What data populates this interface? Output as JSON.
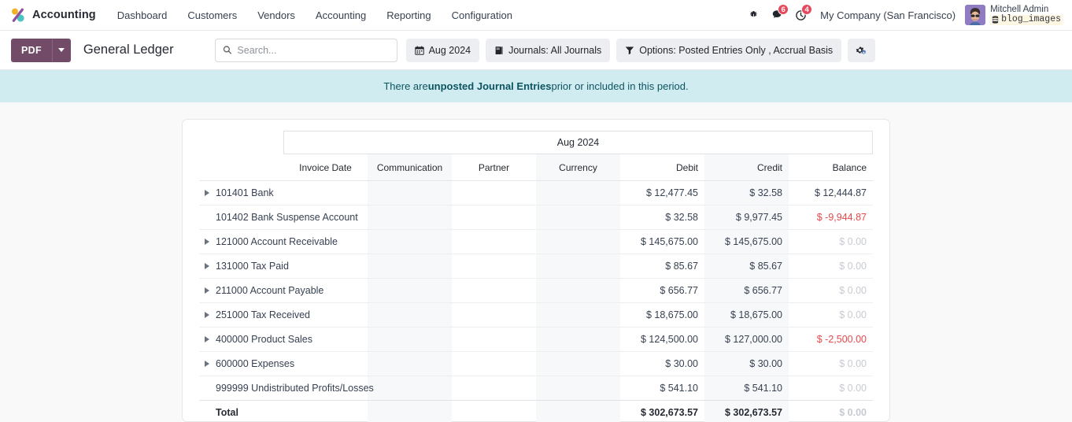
{
  "navbar": {
    "brand": "Accounting",
    "brand_logo_icon": "odoo-accounting-logo",
    "menu": [
      {
        "label": "Dashboard",
        "name": "dashboard"
      },
      {
        "label": "Customers",
        "name": "customers"
      },
      {
        "label": "Vendors",
        "name": "vendors"
      },
      {
        "label": "Accounting",
        "name": "accounting"
      },
      {
        "label": "Reporting",
        "name": "reporting"
      },
      {
        "label": "Configuration",
        "name": "configuration"
      }
    ],
    "sys_icons": [
      {
        "name": "bug-icon",
        "badge": ""
      },
      {
        "name": "messages-icon",
        "badge": "6"
      },
      {
        "name": "activities-clock-icon",
        "badge": "4"
      }
    ],
    "company": "My Company (San Francisco)",
    "user": {
      "name": "Mitchell Admin",
      "database": "blog_images",
      "database_icon": "database-icon",
      "avatar_icon": "user-avatar"
    }
  },
  "control_panel": {
    "pdf_label": "PDF",
    "pdf_caret_icon": "caret-down-icon",
    "page_title": "General Ledger",
    "search": {
      "placeholder": "Search...",
      "value": "",
      "icon": "search-icon"
    },
    "filters": [
      {
        "name": "date-filter",
        "icon": "calendar-icon",
        "label": "Aug 2024"
      },
      {
        "name": "journals-filter",
        "icon": "book-icon",
        "label": "Journals: All Journals"
      },
      {
        "name": "options-filter",
        "icon": "filter-icon",
        "label": "Options: Posted Entries Only , Accrual Basis"
      }
    ],
    "settings_button": {
      "name": "report-settings-button",
      "icon": "cogs-icon"
    }
  },
  "alert": {
    "prefix": "There are ",
    "strong": "unposted Journal Entries",
    "suffix": " prior or included in this period."
  },
  "report": {
    "period_header": "Aug 2024",
    "columns": [
      {
        "key": "name",
        "label": ""
      },
      {
        "key": "invoice_date",
        "label": "Invoice Date"
      },
      {
        "key": "communication",
        "label": "Communication"
      },
      {
        "key": "partner",
        "label": "Partner"
      },
      {
        "key": "currency",
        "label": "Currency"
      },
      {
        "key": "debit",
        "label": "Debit"
      },
      {
        "key": "credit",
        "label": "Credit"
      },
      {
        "key": "balance",
        "label": "Balance"
      }
    ],
    "rows": [
      {
        "account": "101401 Bank",
        "expandable": true,
        "invoice_date": "",
        "communication": "",
        "partner": "",
        "currency": "",
        "debit": "$ 12,477.45",
        "credit": "$ 32.58",
        "balance": "$ 12,444.87",
        "balance_style": "normal"
      },
      {
        "account": "101402 Bank Suspense Account",
        "expandable": false,
        "invoice_date": "",
        "communication": "",
        "partner": "",
        "currency": "",
        "debit": "$ 32.58",
        "credit": "$ 9,977.45",
        "balance": "$ -9,944.87",
        "balance_style": "negative"
      },
      {
        "account": "121000 Account Receivable",
        "expandable": true,
        "invoice_date": "",
        "communication": "",
        "partner": "",
        "currency": "",
        "debit": "$ 145,675.00",
        "credit": "$ 145,675.00",
        "balance": "$ 0.00",
        "balance_style": "zero"
      },
      {
        "account": "131000 Tax Paid",
        "expandable": true,
        "invoice_date": "",
        "communication": "",
        "partner": "",
        "currency": "",
        "debit": "$ 85.67",
        "credit": "$ 85.67",
        "balance": "$ 0.00",
        "balance_style": "zero"
      },
      {
        "account": "211000 Account Payable",
        "expandable": true,
        "invoice_date": "",
        "communication": "",
        "partner": "",
        "currency": "",
        "debit": "$ 656.77",
        "credit": "$ 656.77",
        "balance": "$ 0.00",
        "balance_style": "zero"
      },
      {
        "account": "251000 Tax Received",
        "expandable": true,
        "invoice_date": "",
        "communication": "",
        "partner": "",
        "currency": "",
        "debit": "$ 18,675.00",
        "credit": "$ 18,675.00",
        "balance": "$ 0.00",
        "balance_style": "zero"
      },
      {
        "account": "400000 Product Sales",
        "expandable": true,
        "invoice_date": "",
        "communication": "",
        "partner": "",
        "currency": "",
        "debit": "$ 124,500.00",
        "credit": "$ 127,000.00",
        "balance": "$ -2,500.00",
        "balance_style": "negative"
      },
      {
        "account": "600000 Expenses",
        "expandable": true,
        "invoice_date": "",
        "communication": "",
        "partner": "",
        "currency": "",
        "debit": "$ 30.00",
        "credit": "$ 30.00",
        "balance": "$ 0.00",
        "balance_style": "zero"
      },
      {
        "account": "999999 Undistributed Profits/Losses",
        "expandable": false,
        "invoice_date": "",
        "communication": "",
        "partner": "",
        "currency": "",
        "debit": "$ 541.10",
        "credit": "$ 541.10",
        "balance": "$ 0.00",
        "balance_style": "zero"
      }
    ],
    "total": {
      "account": "Total",
      "expandable": false,
      "invoice_date": "",
      "communication": "",
      "partner": "",
      "currency": "",
      "debit": "$ 302,673.57",
      "credit": "$ 302,673.57",
      "balance": "$ 0.00",
      "balance_style": "zero"
    }
  },
  "colors": {
    "brand_purple": "#714b67",
    "alert_bg": "#d1ecf1",
    "alert_text": "#0c5460",
    "negative": "#e5494d",
    "badge_red": "#e7485b"
  }
}
